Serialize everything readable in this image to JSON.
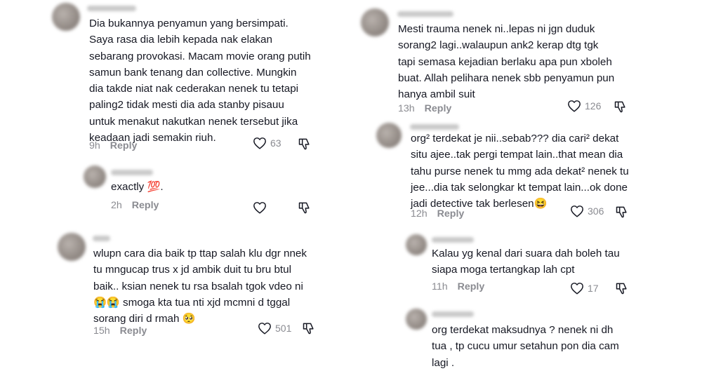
{
  "comments": [
    {
      "text": "Dia bukannya penyamun yang bersimpati.\nSaya rasa dia lebih kepada nak elakan\nsebarang provokasi. Macam movie orang putih\nsamun bank tenang dan collective. Mungkin\ndia takde niat nak cederakan nenek tu tetapi\npaling2 tidak mesti dia ada stanby pisauu\nuntuk menakut nakutkan nenek tersebut jika\nkeadaan jadi semakin riuh.",
      "time": "9h",
      "reply": "Reply",
      "likes": "63"
    },
    {
      "text": "exactly 💯.",
      "time": "2h",
      "reply": "Reply",
      "likes": ""
    },
    {
      "text": "wlupn cara dia baik tp ttap salah klu dgr nnek\ntu mngucap trus x jd ambik duit tu bru btul\nbaik.. ksian nenek tu rsa bsalah tgok vdeo ni\n😭😭 smoga kta tua nti xjd mcmni d tggal\nsorang diri d rmah 🥺",
      "time": "15h",
      "reply": "Reply",
      "likes": "501"
    },
    {
      "text": "Mesti trauma nenek ni..lepas ni jgn duduk\nsorang2 lagi..walaupun ank2 kerap dtg tgk\ntapi semasa kejadian berlaku apa pun xboleh\nbuat. Allah pelihara nenek sbb penyamun pun\nhanya ambil suit",
      "time": "13h",
      "reply": "Reply",
      "likes": "126"
    },
    {
      "text": "org² terdekat je nii..sebab??? dia cari² dekat\nsitu ajee..tak pergi tempat lain..that mean dia\ntahu purse nenek tu mmg ada dekat² nenek tu\njee...dia tak selongkar kt tempat lain...ok done\njadi detective tak berlesen😆",
      "time": "12h",
      "reply": "Reply",
      "likes": "306"
    },
    {
      "text": "Kalau yg kenal dari suara dah boleh tau\nsiapa moga tertangkap lah cpt",
      "time": "11h",
      "reply": "Reply",
      "likes": "17"
    },
    {
      "text": "org terdekat maksudnya ? nenek ni dh\ntua , tp cucu umur setahun pon dia cam\nlagi .",
      "time": "",
      "reply": "",
      "likes": ""
    }
  ],
  "icons": {
    "like": "heart-outline-icon",
    "dislike": "thumbs-down-outline-icon"
  },
  "colors": {
    "text": "#161823",
    "meta": "#8a8b91",
    "background": "#ffffff"
  }
}
